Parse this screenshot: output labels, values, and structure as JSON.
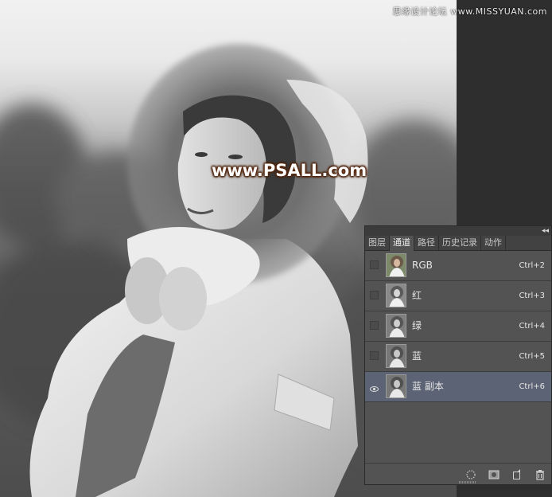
{
  "watermark_top": "思缘设计论坛 www.MISSYUAN.com",
  "watermark_main": "www.PSALL.com",
  "panel": {
    "tabs": [
      {
        "label": "图层",
        "active": false
      },
      {
        "label": "通道",
        "active": true
      },
      {
        "label": "路径",
        "active": false
      },
      {
        "label": "历史记录",
        "active": false
      },
      {
        "label": "动作",
        "active": false
      }
    ],
    "channels": [
      {
        "name": "RGB",
        "shortcut": "Ctrl+2",
        "visible": false,
        "selected": false,
        "thumb": "color"
      },
      {
        "name": "红",
        "shortcut": "Ctrl+3",
        "visible": false,
        "selected": false,
        "thumb": "gray"
      },
      {
        "name": "绿",
        "shortcut": "Ctrl+4",
        "visible": false,
        "selected": false,
        "thumb": "gray"
      },
      {
        "name": "蓝",
        "shortcut": "Ctrl+5",
        "visible": false,
        "selected": false,
        "thumb": "gray"
      },
      {
        "name": "蓝 副本",
        "shortcut": "Ctrl+6",
        "visible": true,
        "selected": true,
        "thumb": "gray"
      }
    ],
    "bottom_icons": [
      "load-selection-icon",
      "save-selection-icon",
      "new-channel-icon",
      "trash-icon"
    ],
    "collapse_icon": "double-chevron-left-icon"
  },
  "colors": {
    "panel_bg": "#535353",
    "selected_row": "#5b6374",
    "watermark_glow": "#5a2a10"
  }
}
